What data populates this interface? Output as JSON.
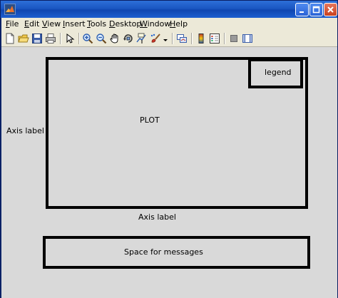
{
  "window": {
    "buttons": [
      "minimize",
      "maximize",
      "close"
    ]
  },
  "menubar": {
    "items": [
      {
        "u": "F",
        "rest": "ile"
      },
      {
        "u": "E",
        "rest": "dit"
      },
      {
        "u": "V",
        "rest": "iew"
      },
      {
        "u": "I",
        "rest": "nsert"
      },
      {
        "u": "T",
        "rest": "ools"
      },
      {
        "u": "D",
        "rest": "esktop"
      },
      {
        "u": "W",
        "rest": "indow"
      },
      {
        "u": "H",
        "rest": "elp"
      }
    ]
  },
  "toolbar": {
    "icons": [
      "new-figure-icon",
      "open-file-icon",
      "save-icon",
      "print-icon",
      "edit-plot-icon",
      "zoom-in-icon",
      "zoom-out-icon",
      "pan-icon",
      "rotate-3d-icon",
      "data-cursor-icon",
      "brush-icon",
      "brush-dropdown-icon",
      "link-plot-icon",
      "insert-colorbar-icon",
      "insert-legend-icon",
      "hide-plot-tools-icon",
      "show-plot-tools-icon"
    ]
  },
  "figure": {
    "plot_label": "PLOT",
    "legend_label": "legend",
    "y_axis_label": "Axis label",
    "x_axis_label": "Axis label",
    "messages_label": "Space for messages"
  }
}
